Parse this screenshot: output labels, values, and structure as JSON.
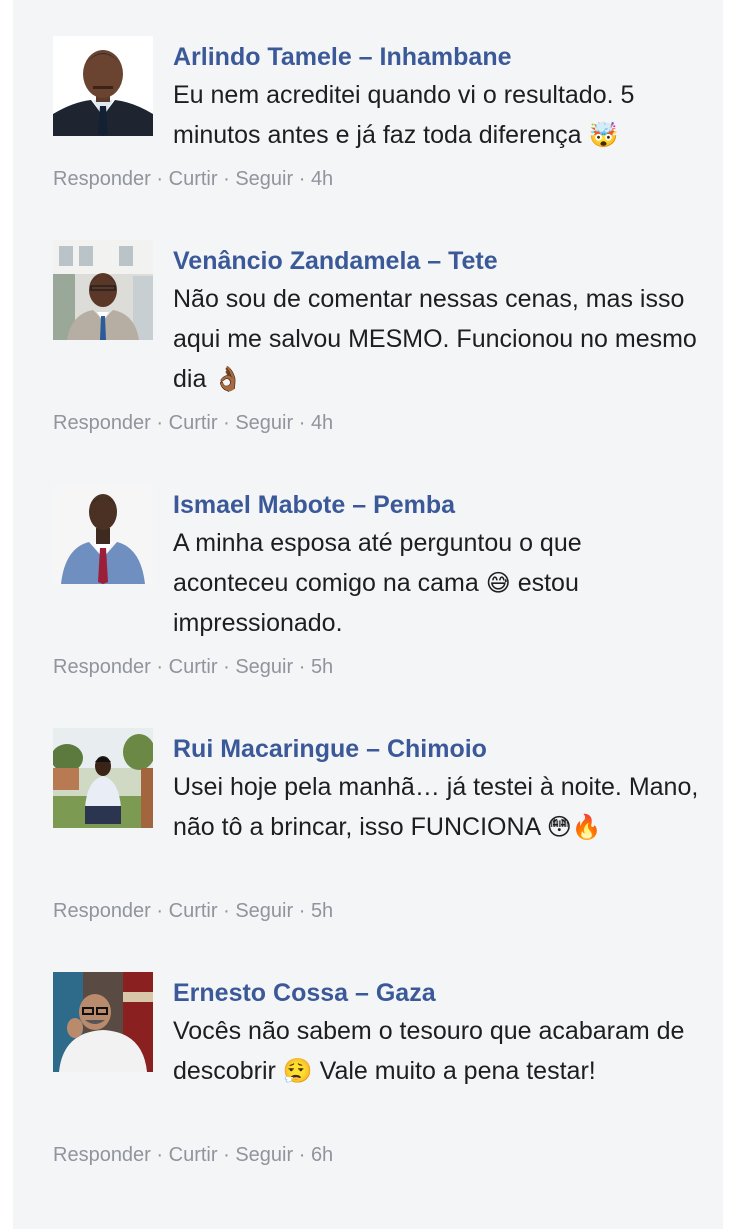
{
  "comments": [
    {
      "author": "Arlindo Tamele – Inhambane",
      "text": "Eu nem acreditei quando vi o resultado. 5 minutos antes e já faz toda diferença",
      "emoji": "🤯",
      "actions": {
        "reply": "Responder",
        "like": "Curtir",
        "follow": "Seguir",
        "time": "4h"
      }
    },
    {
      "author": "Venâncio Zandamela – Tete",
      "text": "Não sou de comentar nessas cenas, mas isso aqui me salvou MESMO. Funcionou no mesmo dia",
      "emoji": "👌🏾",
      "actions": {
        "reply": "Responder",
        "like": "Curtir",
        "follow": "Seguir",
        "time": "4h"
      }
    },
    {
      "author": "Ismael Mabote – Pemba",
      "text_before": "A minha esposa até perguntou o que aconteceu comigo na cama",
      "emoji": "😅",
      "text_after": "estou impressionado.",
      "actions": {
        "reply": "Responder",
        "like": "Curtir",
        "follow": "Seguir",
        "time": "5h"
      }
    },
    {
      "author": "Rui Macaringue – Chimoio",
      "text": "Usei hoje pela manhã… já testei à noite. Mano, não tô a brincar, isso FUNCIONA",
      "emoji": "😳🔥",
      "actions": {
        "reply": "Responder",
        "like": "Curtir",
        "follow": "Seguir",
        "time": "5h"
      }
    },
    {
      "author": "Ernesto Cossa – Gaza",
      "text_before": "Vocês não sabem o tesouro que acabaram de descobrir",
      "emoji": "😮‍💨",
      "text_after": "Vale muito a pena testar!",
      "actions": {
        "reply": "Responder",
        "like": "Curtir",
        "follow": "Seguir",
        "time": "6h"
      }
    }
  ],
  "separator": "·",
  "colors": {
    "author": "#3b5998",
    "text": "#1c1e21",
    "meta": "#90949c",
    "panel": "#f4f5f7"
  }
}
